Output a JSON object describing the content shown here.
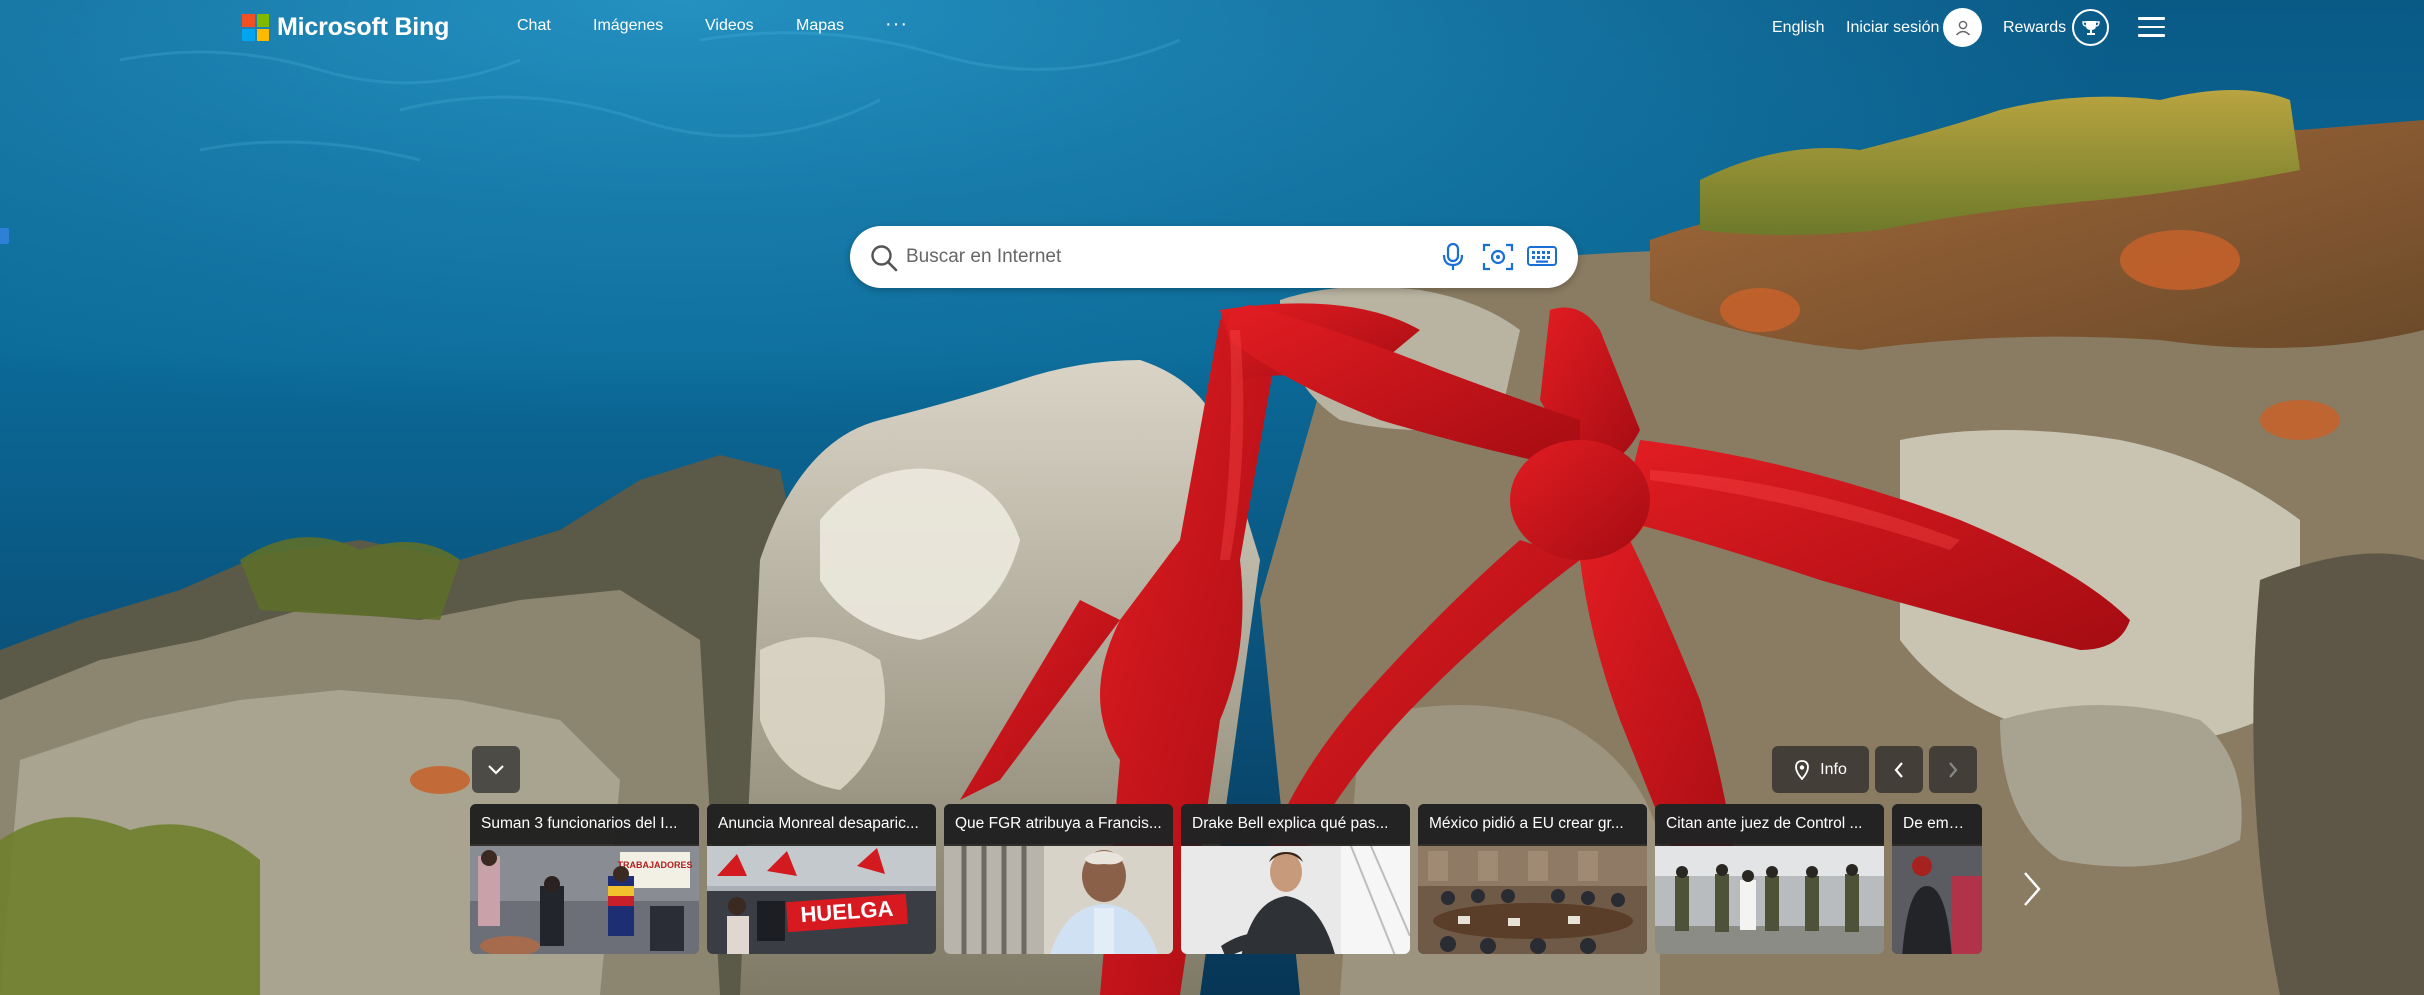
{
  "brand": {
    "name": "Microsoft Bing",
    "logo_colors": [
      "#f25022",
      "#7fba00",
      "#00a4ef",
      "#ffb900"
    ]
  },
  "nav": {
    "items": [
      {
        "label": "Chat"
      },
      {
        "label": "Imágenes"
      },
      {
        "label": "Videos"
      },
      {
        "label": "Mapas"
      }
    ],
    "more_label": "···"
  },
  "header_right": {
    "language": "English",
    "sign_in": "Iniciar sesión",
    "rewards": "Rewards"
  },
  "search": {
    "placeholder": "Buscar en Internet",
    "icons": [
      "search-icon",
      "microphone-icon",
      "visual-search-icon",
      "keyboard-icon"
    ]
  },
  "controls": {
    "info_label": "Info",
    "icons": [
      "chevron-down-icon",
      "location-pin-icon",
      "chevron-left-icon",
      "chevron-right-icon"
    ]
  },
  "news": [
    {
      "title": "Suman 3 funcionarios del I..."
    },
    {
      "title": "Anuncia Monreal desaparic..."
    },
    {
      "title": "Que FGR atribuya a Francis..."
    },
    {
      "title": "Drake Bell explica qué pas..."
    },
    {
      "title": "México pidió a EU crear gr..."
    },
    {
      "title": "Citan ante juez de Control ..."
    },
    {
      "title": "De emplea"
    }
  ],
  "news_thumb_text": {
    "card1_sign": "TRABAJADORES",
    "card2_banner": "HUELGA"
  },
  "accent_colors": {
    "starfish": "#c8141a",
    "water": "#0b5f8c",
    "side_tab": "#2e7fd6"
  }
}
